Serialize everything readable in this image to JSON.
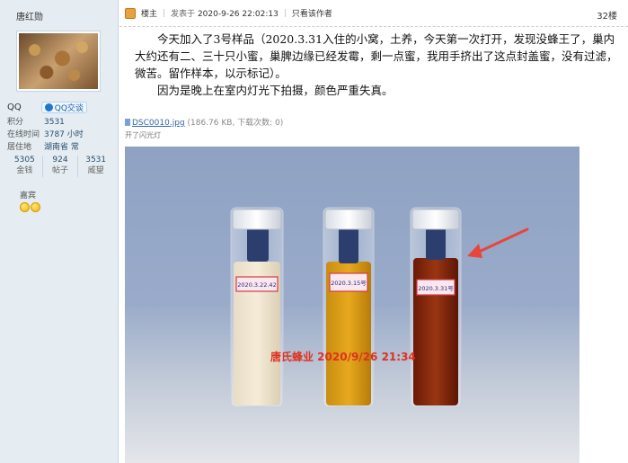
{
  "user": {
    "name": "唐红勋",
    "qq_label": "QQ",
    "qq_button": "QQ交谈",
    "info": [
      {
        "key": "积分",
        "value": "3531"
      },
      {
        "key": "在线时间",
        "value": "3787 小时"
      },
      {
        "key": "居住地",
        "value": "湖南省 常"
      }
    ],
    "stats": [
      {
        "value": "5305",
        "label": "金钱"
      },
      {
        "value": "924",
        "label": "帖子"
      },
      {
        "value": "3531",
        "label": "威望"
      }
    ],
    "group": "嘉宾",
    "medal_count": 2
  },
  "post": {
    "op_badge": "楼主",
    "posted_prefix": "发表于",
    "posted_time": "2020-9-26 22:02:13",
    "only_author": "只看该作者",
    "floor": "32楼",
    "paragraphs": [
      "今天加入了3号样品（2020.3.31入住的小窝，土养，今天第一次打开，发现没蜂王了，巢内大约还有二、三十只小蜜，巢脾边缘已经发霉，剩一点蜜，我用手挤出了这点封盖蜜，没有过滤，微苦。留作样本，以示标记）。",
      "因为是晚上在室内灯光下拍摄，颜色严重失真。"
    ]
  },
  "attachment": {
    "filename": "DSC0010.jpg",
    "meta": "(186.76 KB, 下载次数: 0)",
    "caption": "开了闪光灯"
  },
  "photo": {
    "watermark": "唐氏蜂业 2020/9/26 21:34",
    "vial_labels": [
      "2020.3.22.42",
      "2020.3.15号",
      "2020.3.31号"
    ],
    "watermark_color": "#e0301e",
    "arrow_color": "#e8463a"
  }
}
